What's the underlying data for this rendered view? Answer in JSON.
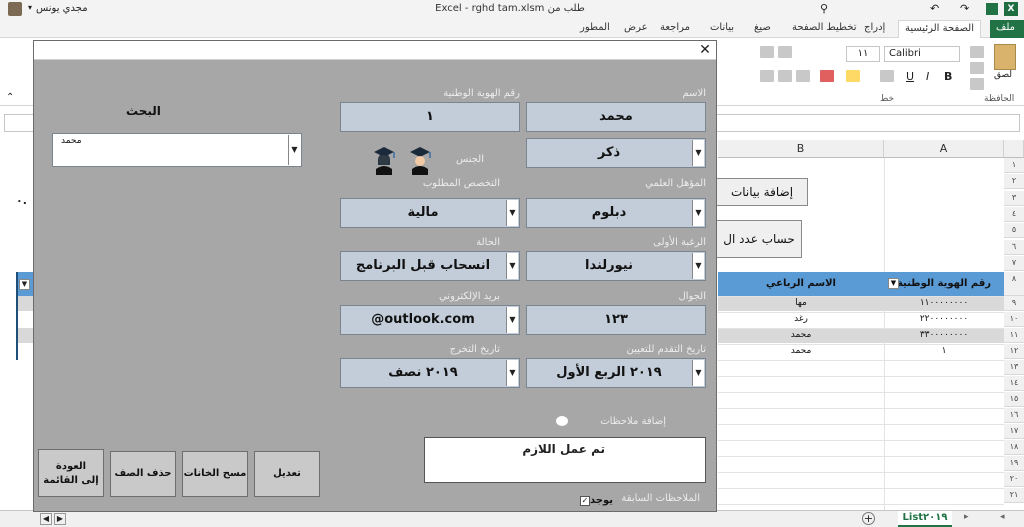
{
  "window": {
    "title": "Excel - rghd tam.xlsm  طلب من"
  },
  "user": {
    "name": "مجدي يونس"
  },
  "ribbon": {
    "tabs": [
      "ملف",
      "الصفحة الرئيسية",
      "إدراج",
      "تخطيط الصفحة",
      "صيغ",
      "بيانات",
      "مراجعة",
      "عرض",
      "المطور"
    ],
    "font_name": "Calibri",
    "font_size": "١١",
    "group_clipboard": "الحافظة",
    "group_font": "خط",
    "paste_label": "لصق"
  },
  "sheet": {
    "col_a": "A",
    "col_b": "B",
    "row_numbers": [
      "١",
      "٢",
      "٣",
      "٤",
      "٥",
      "٦",
      "٧",
      "٨",
      "٩",
      "١٠",
      "١١",
      "١٢",
      "١٣",
      "١٤",
      "١٥",
      "١٦",
      "١٧",
      "١٨",
      "١٩",
      "٢٠",
      "٢١"
    ],
    "add_data_btn": "إضافة بيانات",
    "count_btn": "حساب عدد ال",
    "table_headers": {
      "national_id": "رقم الهوية الوطنية",
      "full_name": "الاسم الرباعي"
    },
    "rows": [
      {
        "id": "١١٠٠٠٠٠٠٠٠",
        "name": "مها"
      },
      {
        "id": "٢٢٠٠٠٠٠٠٠٠",
        "name": "رغد"
      },
      {
        "id": "٣٣٠٠٠٠٠٠٠٠",
        "name": "محمد"
      },
      {
        "id": "١",
        "name": "محمد"
      }
    ],
    "sheet_tab": "List٢٠١٩",
    "edge_char": "٠."
  },
  "form": {
    "labels": {
      "name": "الاسم",
      "national_id": "رقم الهوية الوطنية",
      "gender": "الجنس",
      "qualification": "المؤهل العلمي",
      "desired_specialty": "التخصص المطلوب",
      "first_choice": "الرغبة الأولى",
      "status": "الحالة",
      "mobile": "الجوال",
      "email": "بريد الإلكتروني",
      "graduation_date": "تاريخ التخرج",
      "admission_date": "تاريخ التقدم للتعيين",
      "add_notes": "إضافة ملاحظات",
      "prev_notes": "الملاحظات السابقة",
      "search": "البحث"
    },
    "values": {
      "name": "محمد",
      "national_id": "١",
      "gender": "ذكر",
      "qualification": "دبلوم",
      "desired_specialty": "مالية",
      "first_choice": "نيورلندا",
      "status": "انسحاب قبل البرنامج",
      "mobile": "١٢٣",
      "email": "@outlook.com",
      "graduation_date": "٢٠١٩ الربع الأول",
      "admission_date": "٢٠١٩ نصف",
      "notes": "تم عمل اللازم",
      "search_value": "محمد",
      "exists_label": "يوجد"
    },
    "buttons": {
      "edit": "تعديل",
      "clear": "مسح الخانات",
      "delete": "حذف الصف",
      "back_line1": "العودة",
      "back_line2": "إلى القائمة"
    }
  }
}
